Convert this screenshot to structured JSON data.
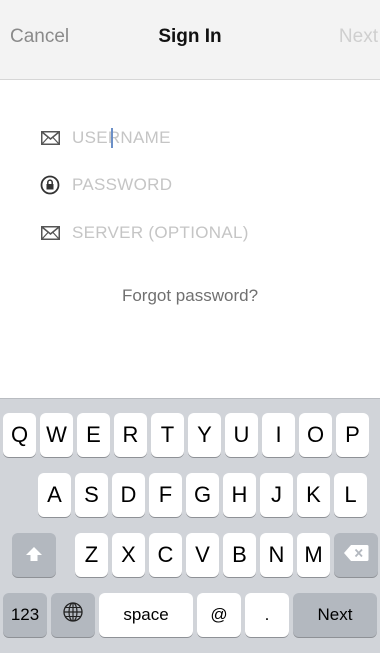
{
  "nav": {
    "cancel": "Cancel",
    "title": "Sign In",
    "next": "Next"
  },
  "form": {
    "username_placeholder": "USERNAME",
    "password_placeholder": "PASSWORD",
    "server_placeholder": "SERVER (OPTIONAL)",
    "forgot": "Forgot password?"
  },
  "icons": {
    "username": "envelope-icon",
    "password": "lock-icon",
    "server": "envelope-icon",
    "shift": "shift-arrow-icon",
    "delete": "delete-backspace-icon",
    "globe": "globe-icon"
  },
  "keyboard": {
    "row1": [
      "Q",
      "W",
      "E",
      "R",
      "T",
      "Y",
      "U",
      "I",
      "O",
      "P"
    ],
    "row2": [
      "A",
      "S",
      "D",
      "F",
      "G",
      "H",
      "J",
      "K",
      "L"
    ],
    "row3": [
      "Z",
      "X",
      "C",
      "V",
      "B",
      "N",
      "M"
    ],
    "numbers": "123",
    "space": "space",
    "at": "@",
    "dot": ".",
    "next": "Next"
  },
  "colors": {
    "caret": "#6b8fc7",
    "keyboard_bg": "#d1d4d9",
    "func_key": "#b3b8bf"
  }
}
